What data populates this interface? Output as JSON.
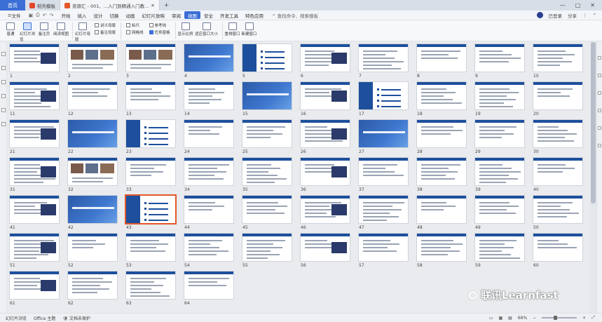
{
  "titlebar": {
    "home_label": "首页",
    "tabs": [
      {
        "label": "稻壳模板",
        "color": "#e2472a"
      },
      {
        "label": "资源汇 - 001、...入门到精通入门教...",
        "color": "#e2572a"
      }
    ],
    "new_tab": "+",
    "controls": [
      "—",
      "□",
      "✕"
    ]
  },
  "menubar": {
    "file_label": "文件",
    "items": [
      "开始",
      "插入",
      "设计",
      "切换",
      "动画",
      "幻灯片放映",
      "审阅",
      "视图",
      "安全",
      "开发工具",
      "特色应用"
    ],
    "active_item": "视图",
    "search_label": "查找命令、搜索模板",
    "right": {
      "collab": "已登录",
      "share": "分享"
    }
  },
  "ribbon": {
    "buttons": [
      {
        "label": "普通",
        "active": false
      },
      {
        "label": "幻灯片浏览",
        "active": true
      },
      {
        "label": "备注页",
        "active": false
      },
      {
        "label": "阅读视图",
        "active": false
      },
      {
        "label": "幻灯片母版",
        "active": false
      },
      {
        "label": "讲义母版",
        "active": false
      },
      {
        "label": "备注母版",
        "active": false
      }
    ],
    "checks": [
      {
        "label": "标尺",
        "on": false
      },
      {
        "label": "网格线",
        "on": false
      },
      {
        "label": "参考线",
        "on": false
      },
      {
        "label": "任务窗格",
        "on": true
      }
    ],
    "more": [
      {
        "label": "显示比例"
      },
      {
        "label": "适应窗口大小"
      },
      {
        "label": "重排窗口"
      },
      {
        "label": "新建窗口"
      }
    ]
  },
  "slides": {
    "count": 64,
    "selected": 43,
    "section_slides": [
      4,
      15,
      22,
      27,
      42
    ],
    "agenda_slides": [
      5,
      17,
      23,
      43
    ],
    "photo_slides": [
      2,
      3,
      32
    ]
  },
  "statusbar": {
    "view": "幻灯片浏览",
    "theme": "Office 主题",
    "protect": "文档未保护",
    "zoom": "66%"
  },
  "watermark": {
    "text": "联讯Learnfast"
  },
  "colors": {
    "accent": "#3b6fd6",
    "slide_header": "#1d4f9c",
    "selection": "#e2572a"
  }
}
